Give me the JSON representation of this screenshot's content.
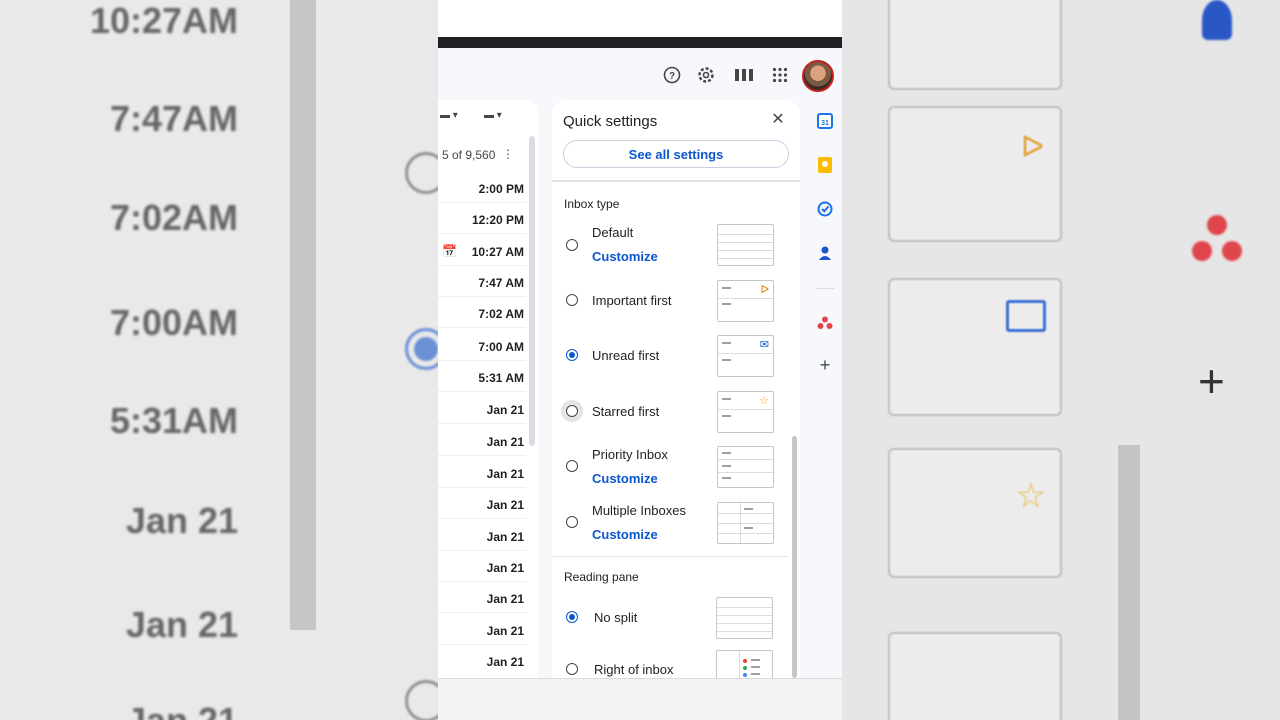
{
  "background_left": {
    "times": [
      "10:27AM",
      "7:47AM",
      "7:02AM",
      "7:00AM",
      "5:31AM",
      "Jan 21",
      "Jan 21",
      "Jan 21"
    ]
  },
  "header": {
    "help_icon": "help-icon",
    "settings_icon": "gear-icon",
    "density_icon": "density-icon",
    "apps_icon": "apps-grid-icon"
  },
  "mail_list": {
    "count": "5 of 9,560",
    "rows": [
      {
        "time": "2:00 PM"
      },
      {
        "time": "12:20 PM"
      },
      {
        "time": "10:27 AM",
        "icon": "calendar-icon"
      },
      {
        "time": "7:47 AM"
      },
      {
        "time": "7:02 AM"
      },
      {
        "time": "7:00 AM"
      },
      {
        "time": "5:31 AM"
      },
      {
        "time": "Jan 21"
      },
      {
        "time": "Jan 21"
      },
      {
        "time": "Jan 21"
      },
      {
        "time": "Jan 21"
      },
      {
        "time": "Jan 21"
      },
      {
        "time": "Jan 21"
      },
      {
        "time": "Jan 21"
      },
      {
        "time": "Jan 21"
      },
      {
        "time": "Jan 21"
      }
    ]
  },
  "quick_settings": {
    "title": "Quick settings",
    "see_all": "See all settings",
    "inbox_type_label": "Inbox type",
    "options": [
      {
        "label": "Default",
        "customize": "Customize",
        "selected": false
      },
      {
        "label": "Important first",
        "selected": false
      },
      {
        "label": "Unread first",
        "selected": true
      },
      {
        "label": "Starred first",
        "selected": false
      },
      {
        "label": "Priority Inbox",
        "customize": "Customize",
        "selected": false
      },
      {
        "label": "Multiple Inboxes",
        "customize": "Customize",
        "selected": false
      }
    ],
    "reading_pane_label": "Reading pane",
    "reading_options": [
      {
        "label": "No split",
        "selected": true
      },
      {
        "label": "Right of inbox",
        "selected": false
      }
    ]
  },
  "side_apps": [
    "calendar-icon",
    "keep-icon",
    "tasks-icon",
    "contacts-icon",
    "asana-icon",
    "add-icon"
  ],
  "colors": {
    "accent": "#0b57d0",
    "important": "#e37400",
    "star": "#f9ab00"
  }
}
